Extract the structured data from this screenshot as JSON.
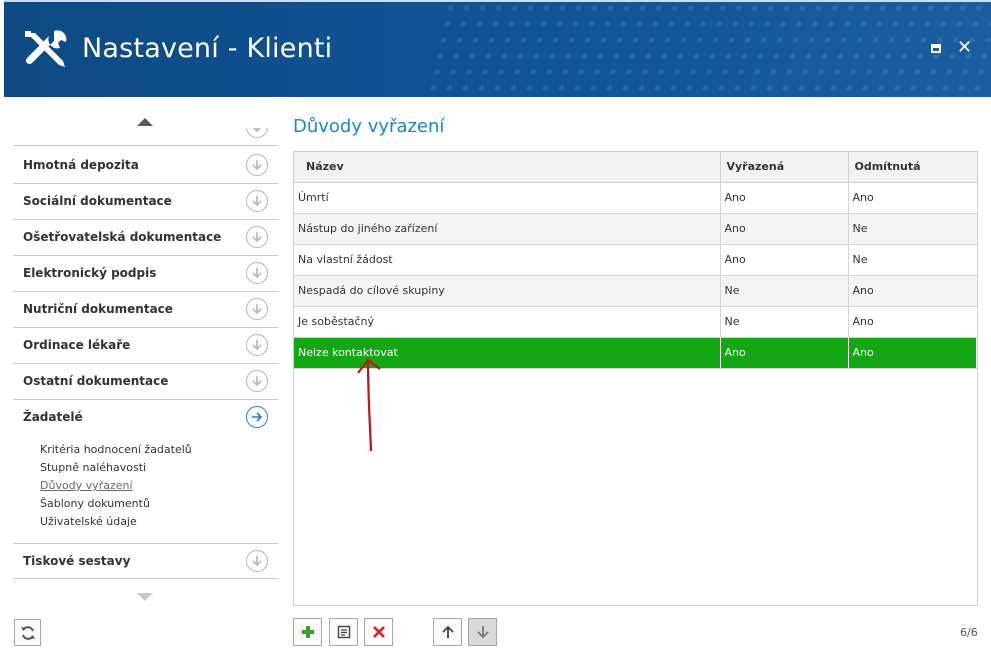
{
  "window": {
    "title": "Nastavení - Klienti",
    "icon": "tools-icon"
  },
  "sidebar": {
    "sections": [
      {
        "label": "Hmotná depozita"
      },
      {
        "label": "Sociální dokumentace"
      },
      {
        "label": "Ošetřovatelská dokumentace"
      },
      {
        "label": "Elektronický podpis"
      },
      {
        "label": "Nutriční dokumentace"
      },
      {
        "label": "Ordinace lékaře"
      },
      {
        "label": "Ostatní dokumentace"
      },
      {
        "label": "Žadatelé"
      },
      {
        "label": "Tiskové sestavy"
      }
    ],
    "active_section": "Žadatelé",
    "sub_items": [
      {
        "label": "Kritéria hodnocení žadatelů"
      },
      {
        "label": "Stupně naléhavosti"
      },
      {
        "label": "Důvody vyřazení"
      },
      {
        "label": "Šablony dokumentů"
      },
      {
        "label": "Uživatelské údaje"
      }
    ],
    "selected_sub_item": "Důvody vyřazení"
  },
  "main": {
    "heading": "Důvody vyřazení",
    "columns": [
      "Název",
      "Vyřazená",
      "Odmítnutá"
    ],
    "rows": [
      [
        "Úmrtí",
        "Ano",
        "Ano"
      ],
      [
        "Nástup do jiného zařízení",
        "Ano",
        "Ne"
      ],
      [
        "Na vlastní žádost",
        "Ano",
        "Ne"
      ],
      [
        "Nespadá do cílové skupiny",
        "Ne",
        "Ano"
      ],
      [
        "Je soběstačný",
        "Ne",
        "Ano"
      ],
      [
        "Nelze kontaktovat",
        "Ano",
        "Ano"
      ]
    ],
    "selected_row": 5
  },
  "toolbar": {
    "buttons": [
      "add-icon",
      "edit-icon",
      "delete-icon",
      "move-up-icon",
      "move-down-icon"
    ],
    "counter": "6/6"
  },
  "colors": {
    "titlebar": "#0f5496",
    "heading": "#1a87c9",
    "selected_row": "#13a713",
    "annotation": "#c0101e"
  }
}
